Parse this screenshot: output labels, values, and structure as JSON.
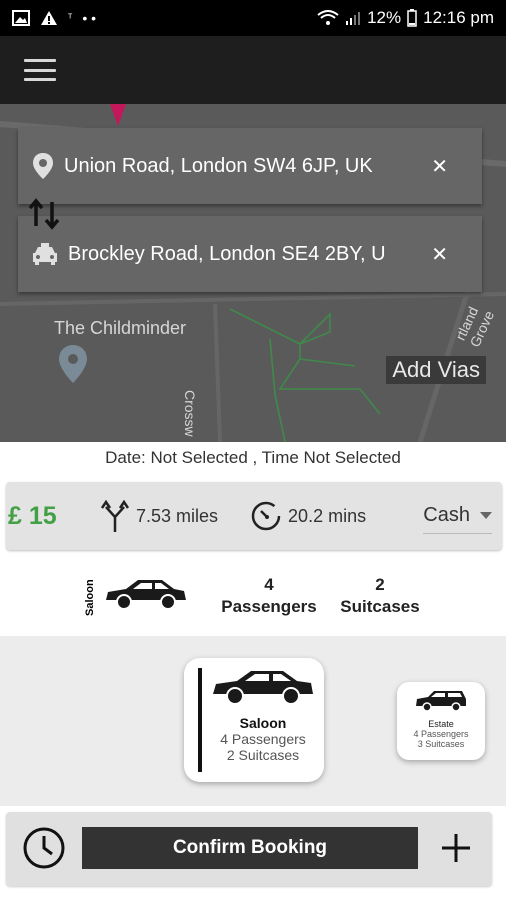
{
  "status_bar": {
    "icons_left": [
      "image-icon",
      "warning-icon",
      "notification-dot-icon",
      "more-dots-icon"
    ],
    "battery": "12%",
    "time": "12:16 pm"
  },
  "map": {
    "pickup": "Union Road, London SW4 6JP, UK",
    "dropoff": "Brockley Road, London SE4 2BY, U",
    "poi_label": "The Childminder",
    "street_crosswa": "Crossw",
    "street_rtland": "rtland Grove",
    "add_vias": "Add Vias"
  },
  "booking": {
    "date_line": "Date: Not Selected , Time  Not Selected",
    "price": "£ 15",
    "distance": "7.53 miles",
    "duration": "20.2 mins",
    "payment": "Cash"
  },
  "summary": {
    "vehicle_type": "Saloon",
    "passengers_count": "4",
    "passengers_label": "Passengers",
    "suitcases_count": "2",
    "suitcases_label": "Suitcases"
  },
  "vehicles": [
    {
      "name": "Saloon",
      "passengers": "4 Passengers",
      "suitcases": "2 Suitcases"
    },
    {
      "name": "Estate",
      "passengers": "4 Passengers",
      "suitcases": "3 Suitcases"
    }
  ],
  "bottom": {
    "confirm_label": "Confirm Booking"
  },
  "colors": {
    "price_green": "#43a047",
    "appbar": "#1e1e1e",
    "confirm_button": "#333333"
  }
}
